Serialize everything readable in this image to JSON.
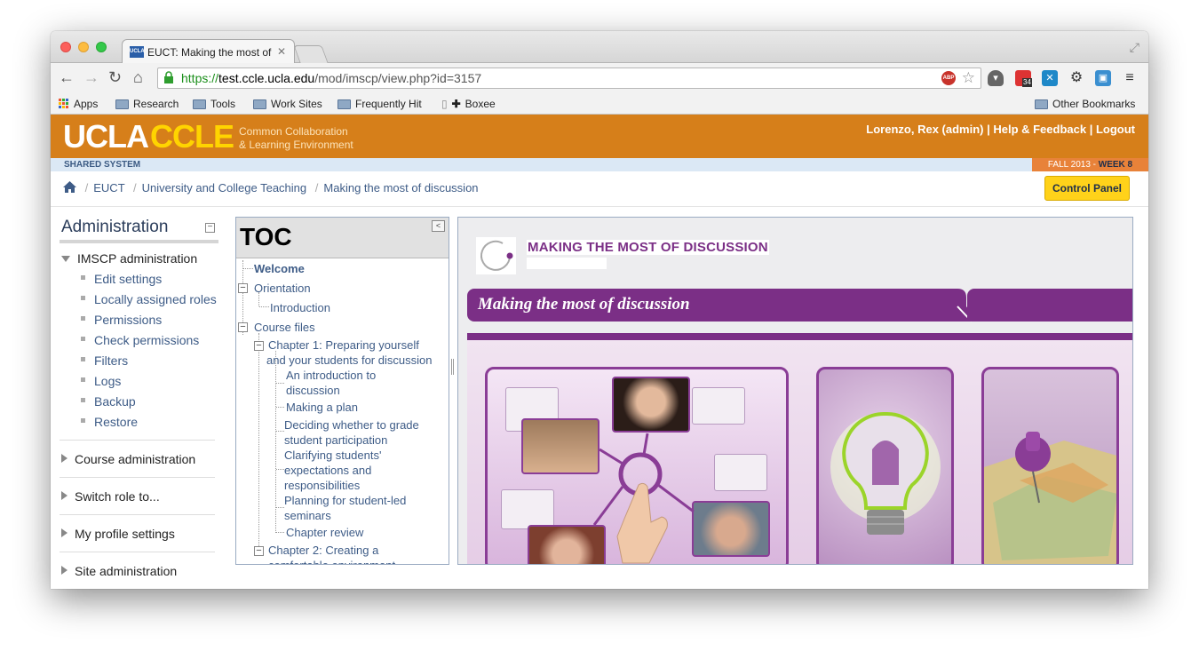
{
  "browser": {
    "tab_title": "EUCT: Making the most of",
    "tab_favicon": "UCLA",
    "url_scheme": "https://",
    "url_host": "test.ccle.ucla.edu",
    "url_path": "/mod/imscp/view.php?id=3157",
    "ext_badge": "34",
    "abp_label": "ABP",
    "bookmarks": [
      "Apps",
      "Research",
      "Tools",
      "Work Sites",
      "Frequently Hit",
      "Boxee"
    ],
    "other_bookmarks": "Other Bookmarks"
  },
  "header": {
    "logo_ucla": "UCLA",
    "logo_ccle": "CCLE",
    "logo_sub1": "Common Collaboration",
    "logo_sub2": "& Learning Environment",
    "user_links": "Lorenzo, Rex (admin) | Help & Feedback | Logout",
    "shared_system": "SHARED SYSTEM",
    "term_prefix": "FALL 2013 - ",
    "term_week": "WEEK 8"
  },
  "breadcrumb": [
    "EUCT",
    "University and College Teaching",
    "Making the most of discussion"
  ],
  "control_panel": "Control Panel",
  "admin": {
    "title": "Administration",
    "imscp_head": "IMSCP administration",
    "items": [
      "Edit settings",
      "Locally assigned roles",
      "Permissions",
      "Check permissions",
      "Filters",
      "Logs",
      "Backup",
      "Restore"
    ],
    "sections": [
      "Course administration",
      "Switch role to...",
      "My profile settings",
      "Site administration"
    ]
  },
  "toc": {
    "title": "TOC",
    "welcome": "Welcome",
    "orientation": "Orientation",
    "introduction": "Introduction",
    "course_files": "Course files",
    "chapter1_a": "Chapter 1: Preparing yourself",
    "chapter1_b": "and your students for discussion",
    "ch1_items": [
      [
        "An introduction to",
        "discussion"
      ],
      [
        "Making a plan"
      ],
      [
        "Deciding whether to grade",
        "student participation"
      ],
      [
        "Clarifying students'",
        "expectations and",
        "responsibilities"
      ],
      [
        "Planning for student-led",
        "seminars"
      ],
      [
        "Chapter review"
      ]
    ],
    "chapter2_a": "Chapter 2: Creating a",
    "chapter2_b": "comfortable environment"
  },
  "content": {
    "header_text": "MAKING THE MOST OF DISCUSSION",
    "banner_title": "Making the most of discussion",
    "accent": "#7b2f86"
  }
}
